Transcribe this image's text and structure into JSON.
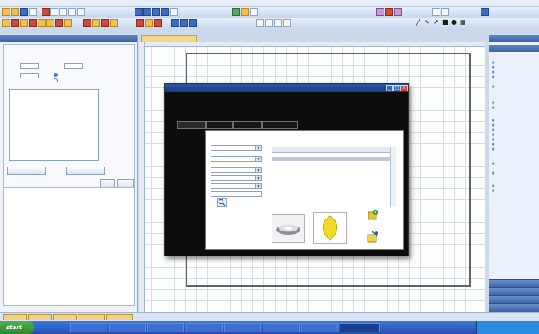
{
  "menubar": {
    "items": [
      "",
      "",
      "",
      "",
      "",
      "",
      "",
      "",
      "",
      ""
    ]
  },
  "project_manager": {
    "title": "",
    "room_editor": {
      "title": "",
      "section": "",
      "length_label": "",
      "length_value": "",
      "width_label": "",
      "width_value": "",
      "height_label": "",
      "height_value": "",
      "coord_options": [
        "",
        ""
      ],
      "coords": [
        [
          "",
          "",
          ""
        ],
        [
          "",
          "",
          ""
        ],
        [
          "",
          "",
          ""
        ],
        [
          "",
          "",
          ""
        ]
      ],
      "buttons": [
        "",
        "",
        "",
        ""
      ]
    },
    "tree": [
      "",
      "",
      ""
    ]
  },
  "document_tab": "",
  "dialog": {
    "title": "",
    "brand": "",
    "header_right": "",
    "tabs": [
      "",
      "",
      "",
      ""
    ],
    "filter_labels": [
      "",
      "",
      "",
      "",
      "",
      ""
    ],
    "results": {
      "title": "",
      "columns": [
        "",
        ""
      ],
      "rows": [
        [
          "",
          ""
        ],
        [
          "",
          ""
        ],
        [
          "",
          ""
        ],
        [
          "",
          ""
        ],
        [
          "",
          ""
        ],
        [
          "",
          ""
        ],
        [
          "",
          ""
        ],
        [
          "",
          ""
        ],
        [
          "",
          ""
        ],
        [
          "",
          ""
        ],
        [
          "",
          ""
        ],
        [
          "",
          ""
        ],
        [
          "",
          ""
        ],
        [
          "",
          ""
        ]
      ]
    }
  },
  "right_panel": {
    "title": "",
    "sections": [
      {
        "title": "",
        "items": [
          "",
          "",
          "",
          "",
          ""
        ]
      },
      {
        "title": "",
        "items": [
          "",
          ""
        ]
      },
      {
        "title": "",
        "items": [
          "",
          "",
          "",
          "",
          "",
          "",
          ""
        ]
      },
      {
        "title": "",
        "items": [
          "",
          ""
        ]
      },
      {
        "title": "",
        "items": [
          "",
          ""
        ]
      }
    ],
    "bottom_bars": [
      "",
      "",
      "",
      ""
    ]
  },
  "status_tabs": [
    "",
    "",
    "",
    "",
    ""
  ],
  "taskbar": {
    "start": "start",
    "tasks": [
      "",
      "",
      "",
      "",
      "",
      "",
      "",
      ""
    ],
    "clock": ""
  }
}
